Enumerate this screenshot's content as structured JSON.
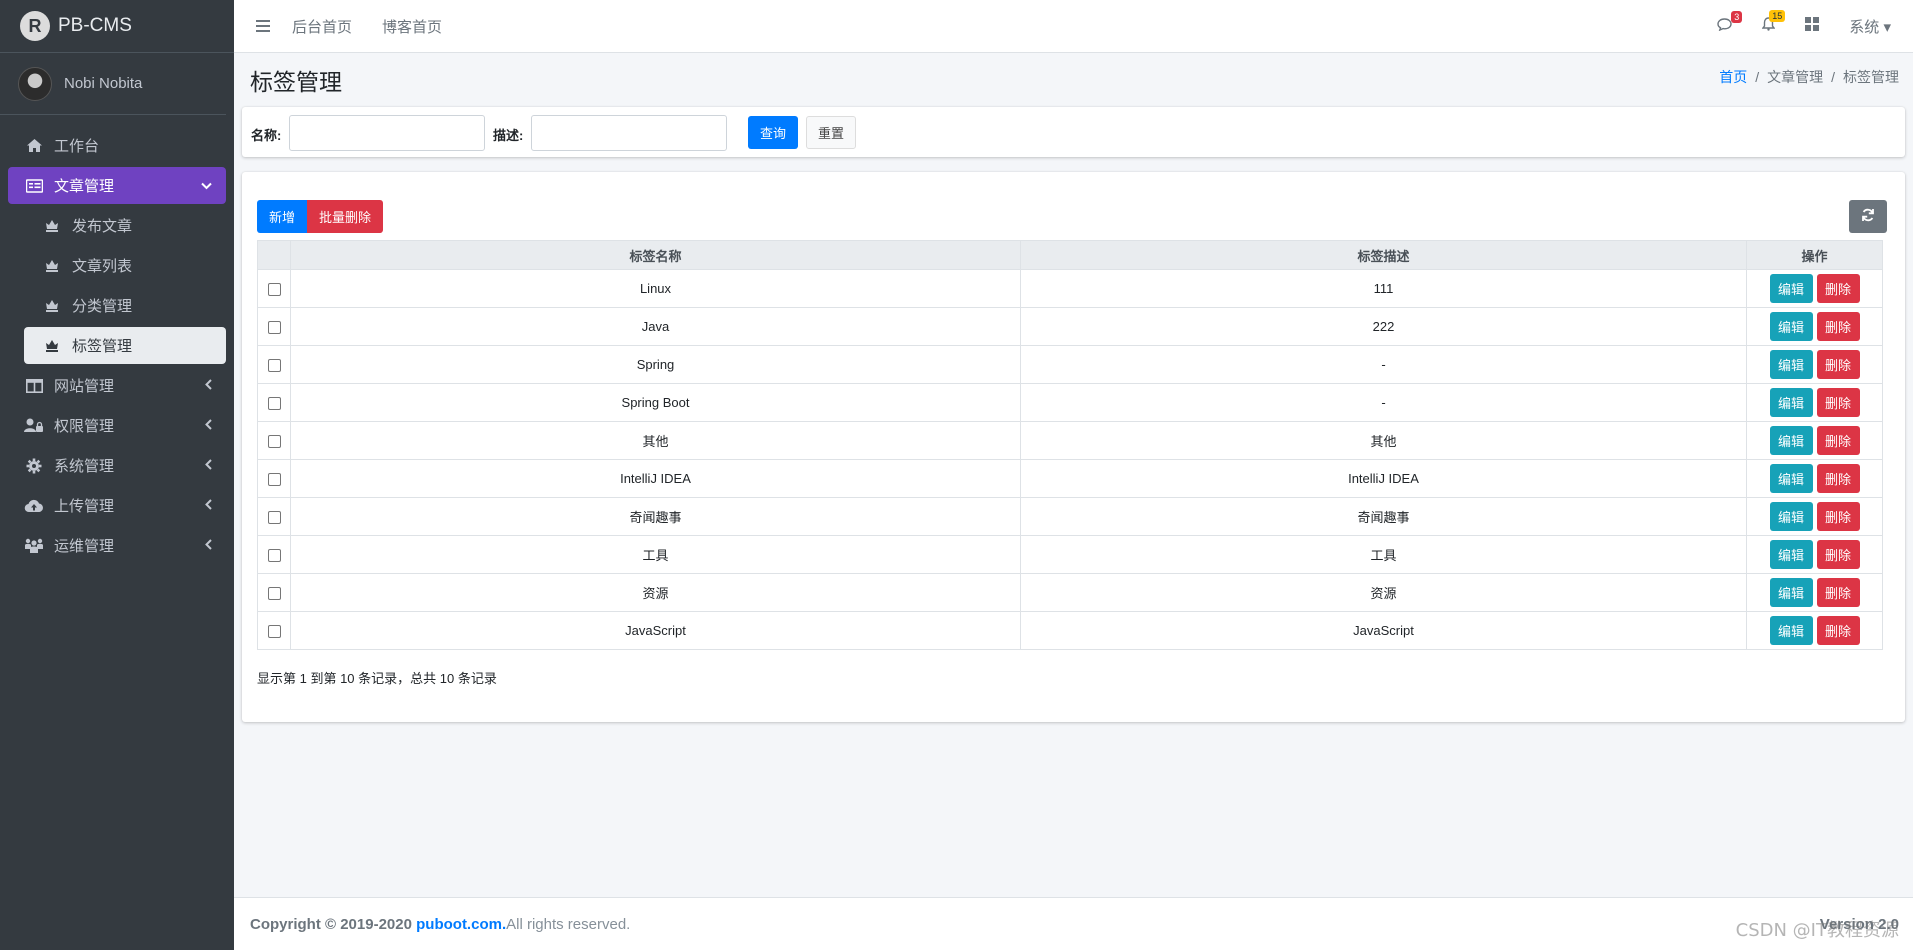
{
  "brand": {
    "name": "PB-CMS",
    "logo_letter": "R"
  },
  "user": {
    "name": "Nobi Nobita"
  },
  "sidebar": {
    "items": [
      {
        "label": "工作台",
        "icon": "home-icon"
      },
      {
        "label": "文章管理",
        "icon": "article-icon",
        "expanded": true
      },
      {
        "label": "网站管理",
        "icon": "columns-icon"
      },
      {
        "label": "权限管理",
        "icon": "user-lock-icon"
      },
      {
        "label": "系统管理",
        "icon": "gear-icon"
      },
      {
        "label": "上传管理",
        "icon": "cloud-upload-icon"
      },
      {
        "label": "运维管理",
        "icon": "team-icon"
      }
    ],
    "sub_items": [
      {
        "label": "发布文章",
        "icon": "chess-icon"
      },
      {
        "label": "文章列表",
        "icon": "chess-icon"
      },
      {
        "label": "分类管理",
        "icon": "chess-icon"
      },
      {
        "label": "标签管理",
        "icon": "chess-icon",
        "active": true
      }
    ]
  },
  "topbar": {
    "links": [
      "后台首页",
      "博客首页"
    ],
    "messages_badge": "3",
    "notifications_badge": "15",
    "system_label": "系统"
  },
  "page": {
    "title": "标签管理",
    "breadcrumb": [
      "首页",
      "文章管理",
      "标签管理"
    ]
  },
  "search": {
    "name_label": "名称:",
    "desc_label": "描述:",
    "name_value": "",
    "desc_value": "",
    "query_button": "查询",
    "reset_button": "重置"
  },
  "toolbar": {
    "add_label": "新增",
    "batch_delete_label": "批量删除"
  },
  "table": {
    "headers": [
      "标签名称",
      "标签描述",
      "操作"
    ],
    "rows": [
      {
        "name": "Linux",
        "desc": "111"
      },
      {
        "name": "Java",
        "desc": "222"
      },
      {
        "name": "Spring",
        "desc": "-"
      },
      {
        "name": "Spring Boot",
        "desc": "-"
      },
      {
        "name": "其他",
        "desc": "其他"
      },
      {
        "name": "IntelliJ IDEA",
        "desc": "IntelliJ IDEA"
      },
      {
        "name": "奇闻趣事",
        "desc": "奇闻趣事"
      },
      {
        "name": "工具",
        "desc": "工具"
      },
      {
        "name": "资源",
        "desc": "资源"
      },
      {
        "name": "JavaScript",
        "desc": "JavaScript"
      }
    ],
    "edit_label": "编辑",
    "delete_label": "删除"
  },
  "pagination": {
    "info": "显示第 1 到第 10 条记录，总共 10 条记录"
  },
  "footer": {
    "copyright_prefix": "Copyright © 2019-2020 ",
    "site": "puboot.com.",
    "suffix": " All rights reserved.",
    "version": "Version 2.0"
  },
  "watermark": "CSDN @IT教程资源"
}
